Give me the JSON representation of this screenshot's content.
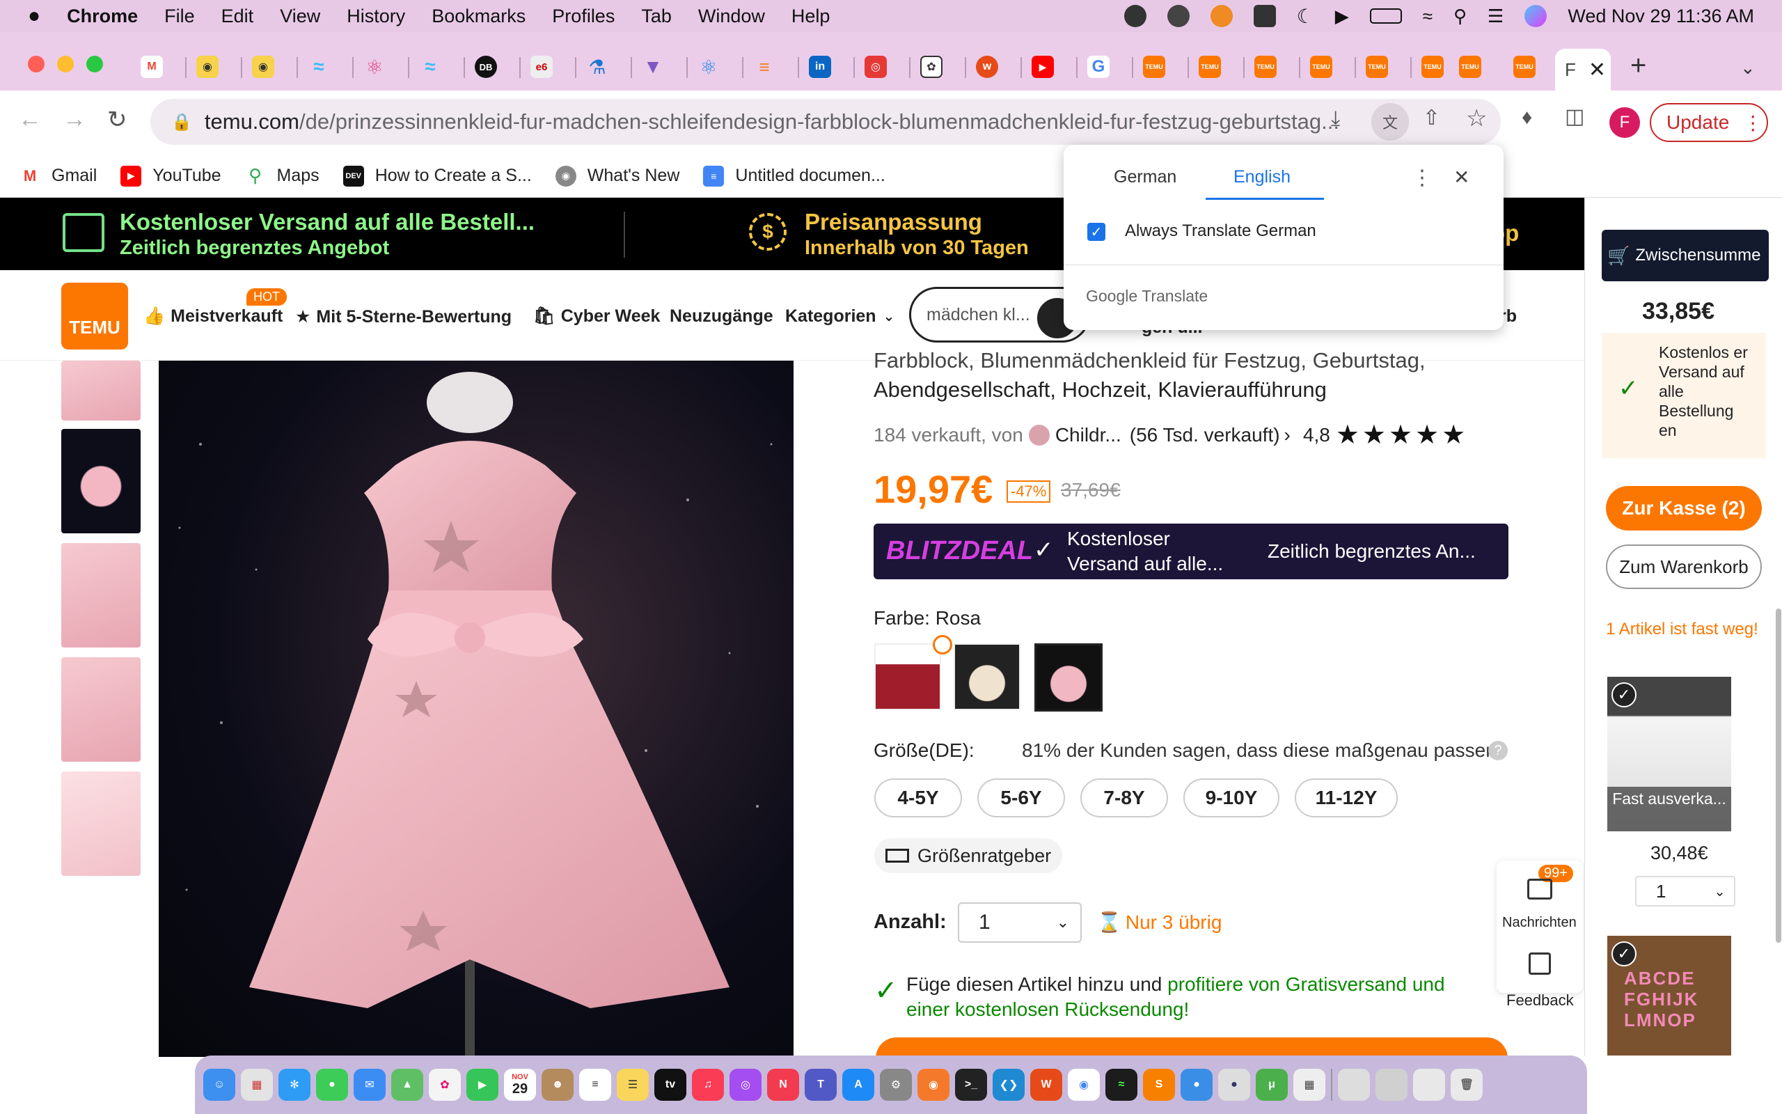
{
  "menubar": {
    "apple": "",
    "app": "Chrome",
    "items": [
      "File",
      "Edit",
      "View",
      "History",
      "Bookmarks",
      "Profiles",
      "Tab",
      "Window",
      "Help"
    ],
    "clock": "Wed Nov 29  11:36 AM"
  },
  "browser": {
    "active_tab_label": "F",
    "url_host": "temu.com",
    "url_path": "/de/prinzessinnenkleid-fur-madchen-schleifendesign-farbblock-blumenmadchenkleid-fur-festzug-geburtstag...",
    "profile_initial": "F",
    "update_label": "Update",
    "tab_icons": [
      "gmail",
      "owl",
      "owl",
      "wave",
      "react",
      "wave",
      "db",
      "e6",
      "flask",
      "vuetify",
      "react",
      "stack",
      "linkedin",
      "redbox",
      "chatgpt",
      "w",
      "youtube",
      "google",
      "temu",
      "temu",
      "temu",
      "temu",
      "temu",
      "temu",
      "temu",
      "temu"
    ]
  },
  "bookmarks": [
    {
      "label": "Gmail",
      "icon": "gmail-icon",
      "color": "#ea4335"
    },
    {
      "label": "YouTube",
      "icon": "youtube-icon",
      "color": "#ff0000"
    },
    {
      "label": "Maps",
      "icon": "maps-icon",
      "color": "#34a853"
    },
    {
      "label": "How to Create a S...",
      "icon": "dev-icon",
      "color": "#111111"
    },
    {
      "label": "What's New",
      "icon": "chrome-icon",
      "color": "#777777"
    },
    {
      "label": "Untitled documen...",
      "icon": "docs-icon",
      "color": "#4285f4"
    }
  ],
  "promo": {
    "shipping_title": "Kostenloser Versand auf alle Bestell...",
    "shipping_sub": "Zeitlich begrenztes Angebot",
    "price_title": "Preisanpassung",
    "price_sub": "Innerhalb von 30 Tagen",
    "right_fragment": "op"
  },
  "nav": {
    "logo": "TEMU",
    "hot": "HOT",
    "best": "Meistverkauft",
    "five_star": "Mit 5-Sterne-Bewertung",
    "cyber": "Cyber Week",
    "new": "Neuzugänge",
    "categories": "Kategorien",
    "search_value": "mädchen kl...",
    "partial1": "gen u...",
    "partial2": "rb"
  },
  "product": {
    "title_line1": "Farbblock, Blumenmädchenkleid für Festzug, Geburtstag,",
    "title_line2": "Abendgesellschaft, Hochzeit, Klavieraufführung",
    "sold": "184 verkauft, von",
    "seller": "Childr...",
    "seller_sold": "(56 Tsd. verkauft)",
    "rating": "4,8",
    "price": "19,97€",
    "discount": "-47%",
    "old_price": "37,69€",
    "blitz_logo": "BLITZDEAL",
    "blitz_shipping1": "Kostenloser",
    "blitz_shipping2": "Versand auf alle...",
    "blitz_limited": "Zeitlich begrenztes An...",
    "color_label": "Farbe: Rosa",
    "size_label": "Größe(DE):",
    "fit_note": "81% der Kunden sagen, dass diese maßgenau passen",
    "sizes": [
      "4-5Y",
      "5-6Y",
      "7-8Y",
      "9-10Y",
      "11-12Y"
    ],
    "size_guide": "Größenratgeber",
    "qty_label": "Anzahl:",
    "qty_value": "1",
    "stock_note": "Nur 3 übrig",
    "add_note_1": "Füge diesen Artikel hinzu und",
    "add_note_2": "profitiere von Gratisversand und",
    "add_note_3": "einer kostenlosen Rücksendung!"
  },
  "float": {
    "messages_badge": "99+",
    "messages": "Nachrichten",
    "feedback": "Feedback"
  },
  "cart": {
    "subtotal_label": "Zwischensumme",
    "subtotal": "33,85€",
    "free_ship": "Kostenlos er Versand auf alle Bestellung en",
    "checkout": "Zur Kasse (2)",
    "to_cart": "Zum Warenkorb",
    "almost_gone": "1 Artikel ist fast weg!",
    "item1_overlay": "Fast ausverka...",
    "item1_price": "30,48€",
    "item1_qty": "1"
  },
  "translate_popup": {
    "tab_german": "German",
    "tab_english": "English",
    "always": "Always Translate German",
    "brand": "Google Translate"
  },
  "dock": {
    "calendar_day": "29",
    "calendar_month": "NOV"
  }
}
